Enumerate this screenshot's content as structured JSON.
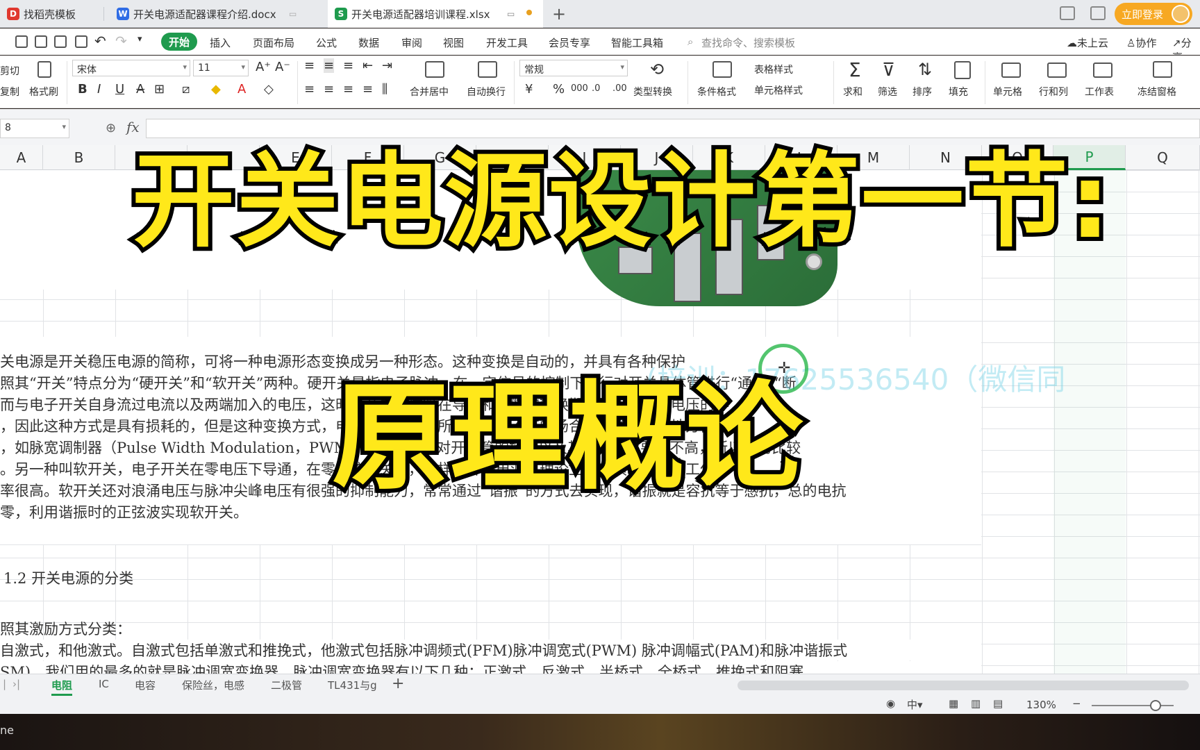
{
  "tabs": [
    {
      "label": "找稻壳模板",
      "icon": "docer-icon",
      "color": "#e0382f"
    },
    {
      "label": "开关电源适配器课程介绍.docx",
      "icon": "wps-writer-icon",
      "color": "#2f6ce5"
    },
    {
      "label": "开关电源适配器培训课程.xlsx",
      "icon": "wps-sheet-icon",
      "color": "#1f9b4e"
    }
  ],
  "header": {
    "login": "立即登录"
  },
  "menu": {
    "start": "开始",
    "items": [
      "插入",
      "页面布局",
      "公式",
      "数据",
      "审阅",
      "视图",
      "开发工具",
      "会员专享",
      "智能工具箱"
    ],
    "search": "查找命令、搜索模板",
    "right": [
      "未上云",
      "协作",
      "分享"
    ]
  },
  "ribbon": {
    "cut": "剪切",
    "copy": "复制",
    "format_painter": "格式刷",
    "font": "宋体",
    "size": "11",
    "merge": "合并居中",
    "wrap": "自动换行",
    "number_format": "常规",
    "type_convert": "类型转换",
    "cond_format": "条件格式",
    "table_style": "表格样式",
    "cell_style": "单元格样式",
    "sum": "求和",
    "filter": "筛选",
    "sort": "排序",
    "fill": "填充",
    "cell": "单元格",
    "rowcol": "行和列",
    "sheet": "工作表",
    "freeze": "冻结窗格"
  },
  "formula": {
    "namebox": "8",
    "fx": "fx"
  },
  "columns": [
    "A",
    "B",
    "C",
    "D",
    "E",
    "F",
    "G",
    "H",
    "I",
    "J",
    "K",
    "L",
    "M",
    "N",
    "O",
    "P",
    "Q"
  ],
  "content": {
    "lines": [
      "关电源是开关稳压电源的简称，可将一种电源形态变换成另一种形态。这种变换是自动的，并具有各种保护",
      "照其“开关”特点分为“硬开关”和“软开关”两种。硬开关是指电子脉冲，在一定信号的控制下强行对开关晶体管进行“通”和“断",
      "而与电子开关自身流过电流以及两端加入的电压，这时候开关晶体管在导通和关断的转换期间是有电流与电压的存",
      "，因此这种方式是具有损耗的，但是这种变换方式，电路比较简单，所以在要求不高的场合硬开关在很多地方仍然应",
      "，如脉宽调制器（Pulse Width Modulation，PWM）开关方式，对开关管的控制以及其他的要求要求不高，所以用的比较",
      "。另一种叫软开关，电子开关在零电压下导通，在零电流下关断，这样的开关电源，理论上，其损耗为零，工作",
      "率很高。软开关还对浪涌电压与脉冲尖峰电压有很强的抑制能力，常常通过“谐振”的方式去实现，谐振就是容抗等于感抗，总的电抗",
      "零，利用谐振时的正弦波实现软开关。"
    ],
    "section": "1.2 开关电源的分类",
    "bottom_lines": [
      "照其激励方式分类：",
      "自激式，和他激式。自激式包括单激式和推挽式，他激式包括脉冲调频式(PFM)脉冲调宽式(PWM) 脉冲调幅式(PAM)和脉冲谐振式",
      "SM)，我们用的最多的就是脉冲调宽变换器，脉冲调宽变换器有以下几种：正激式、反激式、半桥式、全桥式、推挽式和阻塞"
    ],
    "watermark": "(培训：17625536540（微信同"
  },
  "overlay": {
    "title1": "开关电源设计第一节:",
    "title2": "原理概论"
  },
  "sheets": [
    "电阻",
    "IC",
    "电容",
    "保险丝，电感",
    "二极管",
    "TL431与g"
  ],
  "status": {
    "zoom": "130%"
  },
  "video": {
    "caption": "ne"
  }
}
